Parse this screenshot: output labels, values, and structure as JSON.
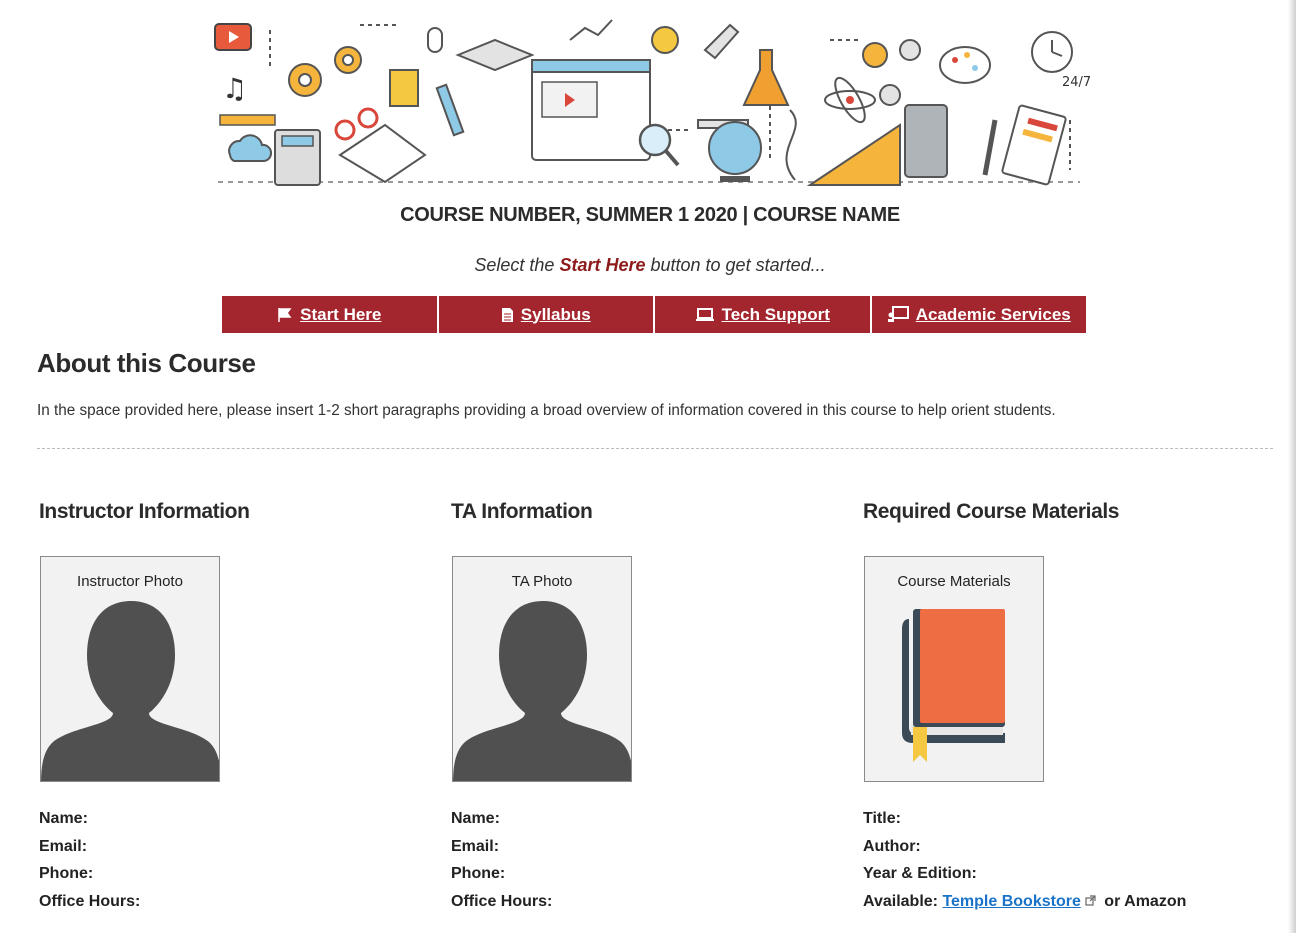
{
  "header": {
    "course_title": "COURSE NUMBER, SUMMER 1 2020 | COURSE NAME",
    "tagline_before": "Select the ",
    "tagline_highlight": "Start Here",
    "tagline_after": " button to get started..."
  },
  "banner": {
    "time_label": "24/7"
  },
  "nav": [
    {
      "label": "Start Here",
      "icon": "flag-icon"
    },
    {
      "label": "Syllabus",
      "icon": "document-icon"
    },
    {
      "label": "Tech Support",
      "icon": "laptop-icon"
    },
    {
      "label": "Academic Services",
      "icon": "presentation-icon"
    }
  ],
  "about": {
    "heading": "About this Course",
    "text": "In the space provided here, please insert 1-2 short paragraphs providing a broad overview of information covered in this course to help orient students."
  },
  "instructor": {
    "heading": "Instructor Information",
    "photo_label": "Instructor Photo",
    "fields": [
      "Name:",
      "Email:",
      "Phone:",
      "Office Hours:"
    ]
  },
  "ta": {
    "heading": "TA Information",
    "photo_label": "TA Photo",
    "fields": [
      "Name:",
      "Email:",
      "Phone:",
      "Office Hours:"
    ]
  },
  "materials": {
    "heading": "Required Course Materials",
    "photo_label": "Course Materials",
    "fields": [
      "Title:",
      "Author:",
      "Year & Edition:"
    ],
    "available_label": "Available: ",
    "bookstore_link": "Temple Bookstore",
    "available_suffix": " or Amazon"
  },
  "colors": {
    "accent": "#a3252e",
    "highlight": "#8e1b1b",
    "link": "#1a73c8",
    "silhouette": "#505050",
    "book": "#ee6d43"
  }
}
